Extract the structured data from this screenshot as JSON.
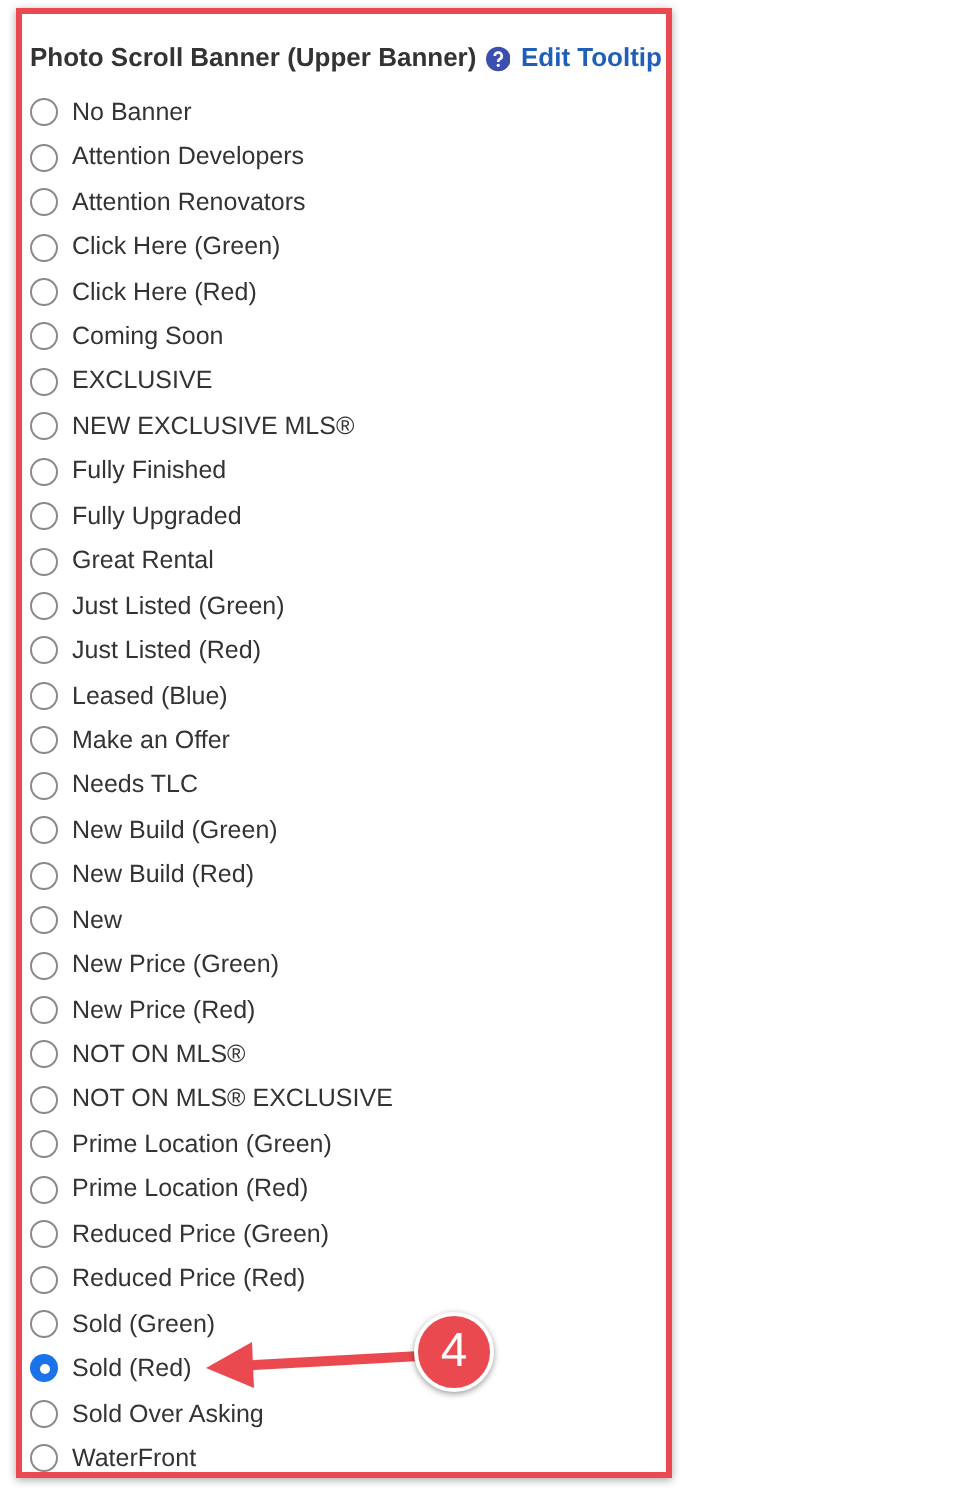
{
  "section": {
    "title": "Photo Scroll Banner (Upper Banner)",
    "help_link": "Edit Tooltip"
  },
  "options": [
    {
      "label": "No Banner",
      "selected": false
    },
    {
      "label": "Attention Developers",
      "selected": false
    },
    {
      "label": "Attention Renovators",
      "selected": false
    },
    {
      "label": "Click Here (Green)",
      "selected": false
    },
    {
      "label": "Click Here (Red)",
      "selected": false
    },
    {
      "label": "Coming Soon",
      "selected": false
    },
    {
      "label": "EXCLUSIVE",
      "selected": false
    },
    {
      "label": "NEW EXCLUSIVE MLS®",
      "selected": false
    },
    {
      "label": "Fully Finished",
      "selected": false
    },
    {
      "label": "Fully Upgraded",
      "selected": false
    },
    {
      "label": "Great Rental",
      "selected": false
    },
    {
      "label": "Just Listed (Green)",
      "selected": false
    },
    {
      "label": "Just Listed (Red)",
      "selected": false
    },
    {
      "label": "Leased (Blue)",
      "selected": false
    },
    {
      "label": "Make an Offer",
      "selected": false
    },
    {
      "label": "Needs TLC",
      "selected": false
    },
    {
      "label": "New Build (Green)",
      "selected": false
    },
    {
      "label": "New Build (Red)",
      "selected": false
    },
    {
      "label": "New",
      "selected": false
    },
    {
      "label": "New Price (Green)",
      "selected": false
    },
    {
      "label": "New Price (Red)",
      "selected": false
    },
    {
      "label": "NOT ON MLS®",
      "selected": false
    },
    {
      "label": "NOT ON MLS® EXCLUSIVE",
      "selected": false
    },
    {
      "label": "Prime Location (Green)",
      "selected": false
    },
    {
      "label": "Prime Location (Red)",
      "selected": false
    },
    {
      "label": "Reduced Price (Green)",
      "selected": false
    },
    {
      "label": "Reduced Price (Red)",
      "selected": false
    },
    {
      "label": "Sold (Green)",
      "selected": false
    },
    {
      "label": "Sold (Red)",
      "selected": true
    },
    {
      "label": "Sold Over Asking",
      "selected": false
    },
    {
      "label": "WaterFront",
      "selected": false
    }
  ],
  "annotation": {
    "label": "4"
  }
}
